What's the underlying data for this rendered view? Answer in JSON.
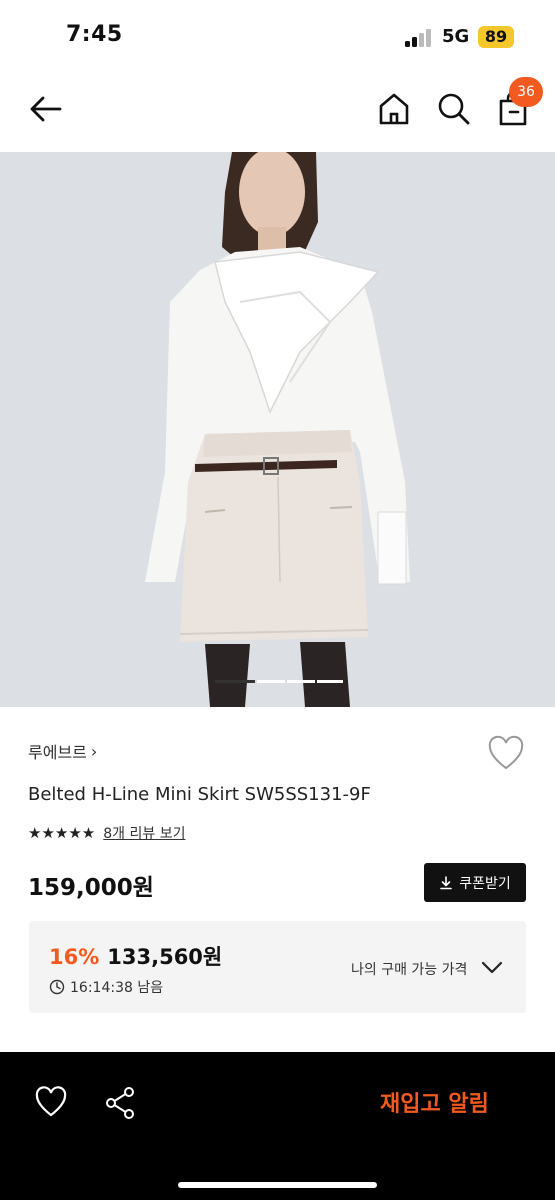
{
  "status_bar": {
    "time": "7:45",
    "network": "5G",
    "battery": "89",
    "battery_color": "#f4c82a"
  },
  "nav": {
    "icons": [
      "back-arrow-icon",
      "home-icon",
      "search-icon",
      "shopping-bag-icon"
    ],
    "cart_count": "36"
  },
  "product_image": {
    "description_icon": "product-photo-model-white-shirt-belted-skirt",
    "carousel_active_index": 1,
    "carousel_count": 4
  },
  "product": {
    "brand": "루에브르",
    "brand_chevron": "›",
    "title": "Belted H-Line Mini Skirt SW5SS131-9F",
    "rating": 4.5,
    "stars": "★★★★★",
    "review_link": "8개 리뷰 보기",
    "price": "159,000원",
    "coupon_button": "쿠폰받기",
    "coupon_icon": "download-icon"
  },
  "deal": {
    "discount": "16%",
    "discounted_price": "133,560원",
    "countdown": "16:14:38 남음",
    "my_price_label": "나의 구매 가능 가격"
  },
  "bottom_bar": {
    "icons": [
      "heart-icon",
      "share-icon"
    ],
    "restock_label": "재입고 알림"
  },
  "colors": {
    "accent": "#f25a1f",
    "dark": "#111111",
    "panel": "#f4f4f4"
  }
}
